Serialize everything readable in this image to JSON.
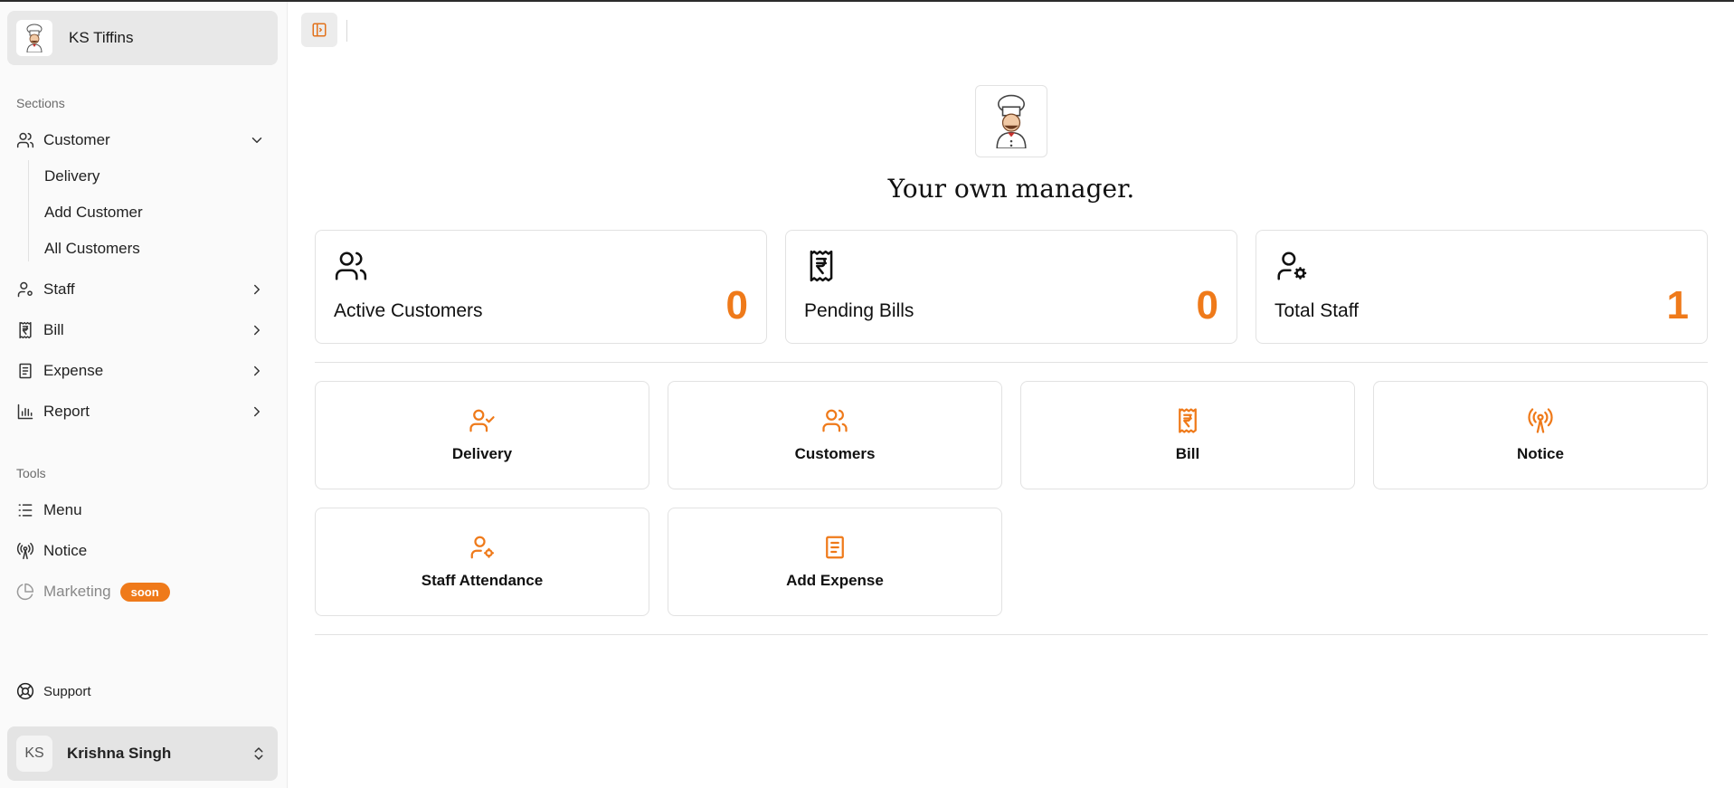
{
  "sidebar": {
    "brand": {
      "name": "KS Tiffins",
      "logo_icon": "chef-icon"
    },
    "sections_label": "Sections",
    "tools_label": "Tools",
    "customer": {
      "label": "Customer",
      "children": [
        "Delivery",
        "Add Customer",
        "All Customers"
      ]
    },
    "staff": {
      "label": "Staff"
    },
    "bill": {
      "label": "Bill"
    },
    "expense": {
      "label": "Expense"
    },
    "report": {
      "label": "Report"
    },
    "menu": {
      "label": "Menu"
    },
    "notice": {
      "label": "Notice"
    },
    "marketing": {
      "label": "Marketing",
      "badge": "soon"
    },
    "support": {
      "label": "Support"
    },
    "user": {
      "initials": "KS",
      "name": "Krishna Singh"
    }
  },
  "main": {
    "title": "Your own manager.",
    "stats": [
      {
        "label": "Active Customers",
        "value": "0",
        "icon": "users-icon"
      },
      {
        "label": "Pending Bills",
        "value": "0",
        "icon": "rupee-receipt-icon"
      },
      {
        "label": "Total Staff",
        "value": "1",
        "icon": "user-cog-icon"
      }
    ],
    "actions": [
      {
        "label": "Delivery",
        "icon": "user-check-icon"
      },
      {
        "label": "Customers",
        "icon": "users-icon"
      },
      {
        "label": "Bill",
        "icon": "rupee-receipt-icon"
      },
      {
        "label": "Notice",
        "icon": "radio-tower-icon"
      },
      {
        "label": "Staff Attendance",
        "icon": "user-cog-icon"
      },
      {
        "label": "Add Expense",
        "icon": "receipt-icon"
      }
    ]
  },
  "colors": {
    "accent": "#ef7a1a"
  }
}
